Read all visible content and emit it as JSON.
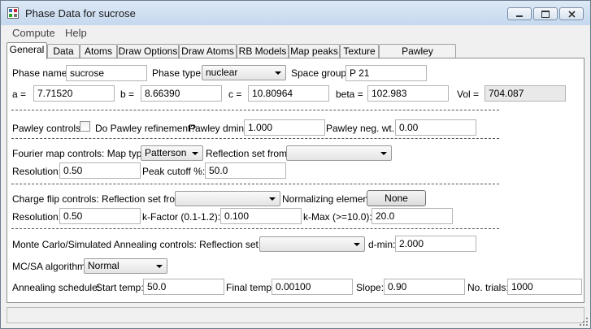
{
  "window": {
    "title": "Phase Data for sucrose"
  },
  "menu": [
    "Compute",
    "Help"
  ],
  "tabs": [
    "General",
    "Data",
    "Atoms",
    "Draw Options",
    "Draw Atoms",
    "RB Models",
    "Map peaks",
    "Texture",
    "Pawley reflections"
  ],
  "general": {
    "phase_name_label": "Phase name:",
    "phase_name": "sucrose",
    "phase_type_label": "Phase type:",
    "phase_type": "nuclear",
    "space_group_label": "Space group:",
    "space_group": "P 21",
    "a_label": "a =",
    "a": "7.71520",
    "b_label": "b =",
    "b": "8.66390",
    "c_label": "c =",
    "c": "10.80964",
    "beta_label": "beta =",
    "beta": "102.983",
    "vol_label": "Vol =",
    "vol": "704.087"
  },
  "pawley": {
    "label": "Pawley controls:",
    "refine_label": "Do Pawley refinement?",
    "dmin_label": "Pawley dmin:",
    "dmin": "1.000",
    "neg_label": "Pawley neg. wt.:",
    "neg": "0.00"
  },
  "fourier": {
    "label": "Fourier map controls: Map type:",
    "map_type": "Patterson",
    "refl_label": "Reflection set from:",
    "refl": "",
    "res_label": "Resolution:",
    "res": "0.50",
    "peak_label": "Peak cutoff %:",
    "peak": "50.0"
  },
  "charge": {
    "label": "Charge flip controls: Reflection set from:",
    "refl": "",
    "norm_label": "Normalizing element:",
    "norm_btn": "None",
    "res_label": "Resolution:",
    "res": "0.50",
    "k_label": "k-Factor (0.1-1.2):",
    "k": "0.100",
    "kmax_label": "k-Max (>=10.0):",
    "kmax": "20.0"
  },
  "mcsa": {
    "label": "Monte Carlo/Simulated Annealing controls: Reflection set from:",
    "refl": "",
    "dmin_label": "d-min:",
    "dmin": "2.000",
    "alg_label": "MC/SA algorithm:",
    "alg": "Normal",
    "sched_label": "Annealing schedule:",
    "start_label": "Start temp:",
    "start": "50.0",
    "final_label": "Final temp:",
    "final": "0.00100",
    "slope_label": "Slope:",
    "slope": "0.90",
    "trials_label": "No. trials:",
    "trials": "1000"
  }
}
